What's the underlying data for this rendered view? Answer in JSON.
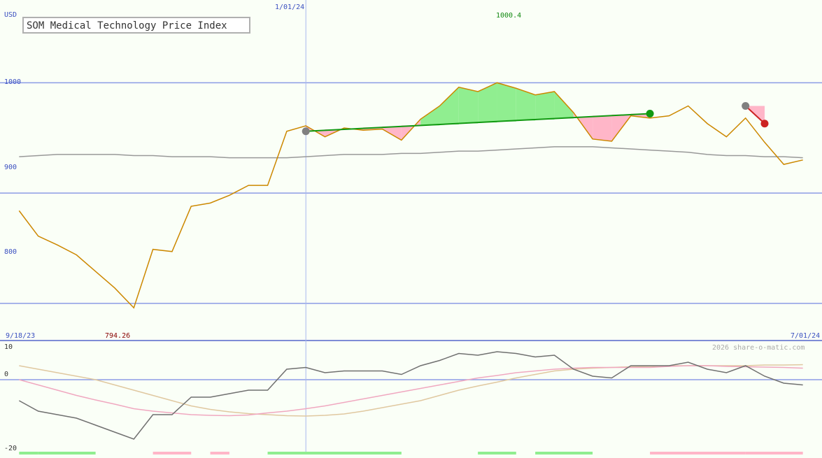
{
  "chart_data": {
    "type": "line",
    "title": "SOM Medical Technology Price Index",
    "currency": "USD",
    "x_start": "9/18/23",
    "x_end": "7/01/24",
    "x_marker": "1/01/24",
    "max_label": "1000.4",
    "min_label": "794.26",
    "copyright": "2026 share-o-matic.com",
    "main_panel": {
      "y_ticks": [
        "1000",
        "900",
        "800"
      ],
      "ylim": [
        767,
        1075
      ],
      "x": [
        "2023-09-18",
        "2023-09-25",
        "2023-10-02",
        "2023-10-09",
        "2023-10-16",
        "2023-10-23",
        "2023-10-30",
        "2023-11-06",
        "2023-11-13",
        "2023-11-20",
        "2023-11-27",
        "2023-12-04",
        "2023-12-11",
        "2023-12-18",
        "2023-12-25",
        "2024-01-01",
        "2024-01-08",
        "2024-01-15",
        "2024-01-22",
        "2024-01-29",
        "2024-02-05",
        "2024-02-12",
        "2024-02-19",
        "2024-02-26",
        "2024-03-04",
        "2024-03-11",
        "2024-03-18",
        "2024-03-25",
        "2024-04-01",
        "2024-04-08",
        "2024-04-15",
        "2024-04-22",
        "2024-04-29",
        "2024-05-06",
        "2024-05-13",
        "2024-05-20",
        "2024-05-27",
        "2024-06-03",
        "2024-06-10",
        "2024-06-17",
        "2024-06-24",
        "2024-07-01"
      ],
      "series": [
        {
          "role": "price",
          "color": "#cc8800",
          "values": [
            884,
            861,
            853,
            844,
            829,
            814,
            796,
            849,
            847,
            888,
            891,
            898,
            907,
            907,
            956,
            961,
            951,
            959,
            957,
            958,
            948,
            967,
            979,
            996,
            992,
            1000,
            995,
            989,
            992,
            973,
            949,
            947,
            970,
            968,
            970,
            979,
            963,
            951,
            968,
            946,
            926,
            930
          ]
        },
        {
          "role": "moving-average",
          "color": "#999999",
          "values": [
            933,
            934,
            935,
            935,
            935,
            935,
            934,
            934,
            933,
            933,
            933,
            932,
            932,
            932,
            932,
            933,
            934,
            935,
            935,
            935,
            936,
            936,
            937,
            938,
            938,
            939,
            940,
            941,
            942,
            942,
            942,
            941,
            940,
            939,
            938,
            937,
            935,
            934,
            934,
            933,
            933,
            932
          ]
        }
      ],
      "trend_lines": [
        {
          "from": "2024-01-01",
          "from_value": 956,
          "to": "2024-05-06",
          "to_value": 972,
          "color": "#119911"
        },
        {
          "from": "2024-06-10",
          "from_value": 979,
          "to": "2024-06-17",
          "to_value": 963,
          "color": "#cc2222"
        }
      ]
    },
    "oscillator_panel": {
      "y_ticks": [
        "10",
        "0",
        "-20"
      ],
      "ylim": [
        -21,
        11
      ],
      "series": [
        {
          "role": "momentum",
          "color": "#707070",
          "values": [
            -6,
            -9,
            -10,
            -11,
            -13,
            -15,
            -17,
            -10,
            -10,
            -5,
            -5,
            -4,
            -3,
            -3,
            3,
            3.5,
            2,
            2.5,
            2.5,
            2.5,
            1.5,
            4,
            5.5,
            7.5,
            7,
            8,
            7.5,
            6.5,
            7,
            3,
            1,
            0.5,
            4,
            4,
            4,
            5,
            3,
            2,
            4,
            1,
            -1,
            -1.5
          ]
        },
        {
          "role": "signal-fast",
          "color": "#f0a8c0",
          "values": [
            0,
            -1.5,
            -3,
            -4.5,
            -5.8,
            -7,
            -8.3,
            -9,
            -9.5,
            -10,
            -10.2,
            -10.3,
            -10.1,
            -9.5,
            -9,
            -8.3,
            -7.5,
            -6.5,
            -5.5,
            -4.5,
            -3.5,
            -2.5,
            -1.5,
            -0.5,
            0.5,
            1.2,
            2,
            2.5,
            3,
            3.3,
            3.5,
            3.5,
            3.5,
            3.5,
            3.8,
            4,
            4,
            3.8,
            3.7,
            3.6,
            3.5,
            3.3
          ]
        },
        {
          "role": "signal-slow",
          "color": "#e0c8a0",
          "values": [
            4,
            3,
            2,
            1,
            0,
            -1.5,
            -3,
            -4.5,
            -6,
            -7.5,
            -8.5,
            -9.2,
            -9.7,
            -10,
            -10.3,
            -10.4,
            -10.2,
            -9.8,
            -9,
            -8,
            -7,
            -6,
            -4.5,
            -3,
            -1.8,
            -0.7,
            0.5,
            1.5,
            2.5,
            3,
            3.3,
            3.5,
            3.7,
            3.8,
            4,
            4,
            4,
            4,
            4,
            4.2,
            4.2,
            4.3
          ]
        }
      ]
    },
    "signal_strip": {
      "bars": [
        {
          "from": "2023-09-18",
          "to": "2023-09-25",
          "color": "#90ee90"
        },
        {
          "from": "2023-09-25",
          "to": "2023-10-16",
          "color": "#90ee90"
        },
        {
          "from": "2023-11-06",
          "to": "2023-11-20",
          "color": "#ffb6c8"
        },
        {
          "from": "2023-11-27",
          "to": "2023-12-04",
          "color": "#ffb6c8"
        },
        {
          "from": "2023-12-18",
          "to": "2024-02-05",
          "color": "#90ee90"
        },
        {
          "from": "2024-03-04",
          "to": "2024-03-18",
          "color": "#90ee90"
        },
        {
          "from": "2024-03-25",
          "to": "2024-04-15",
          "color": "#90ee90"
        },
        {
          "from": "2024-05-06",
          "to": "2024-06-10",
          "color": "#ffb6c8"
        },
        {
          "from": "2024-06-10",
          "to": "2024-07-01",
          "color": "#ffb6c8"
        }
      ]
    }
  }
}
